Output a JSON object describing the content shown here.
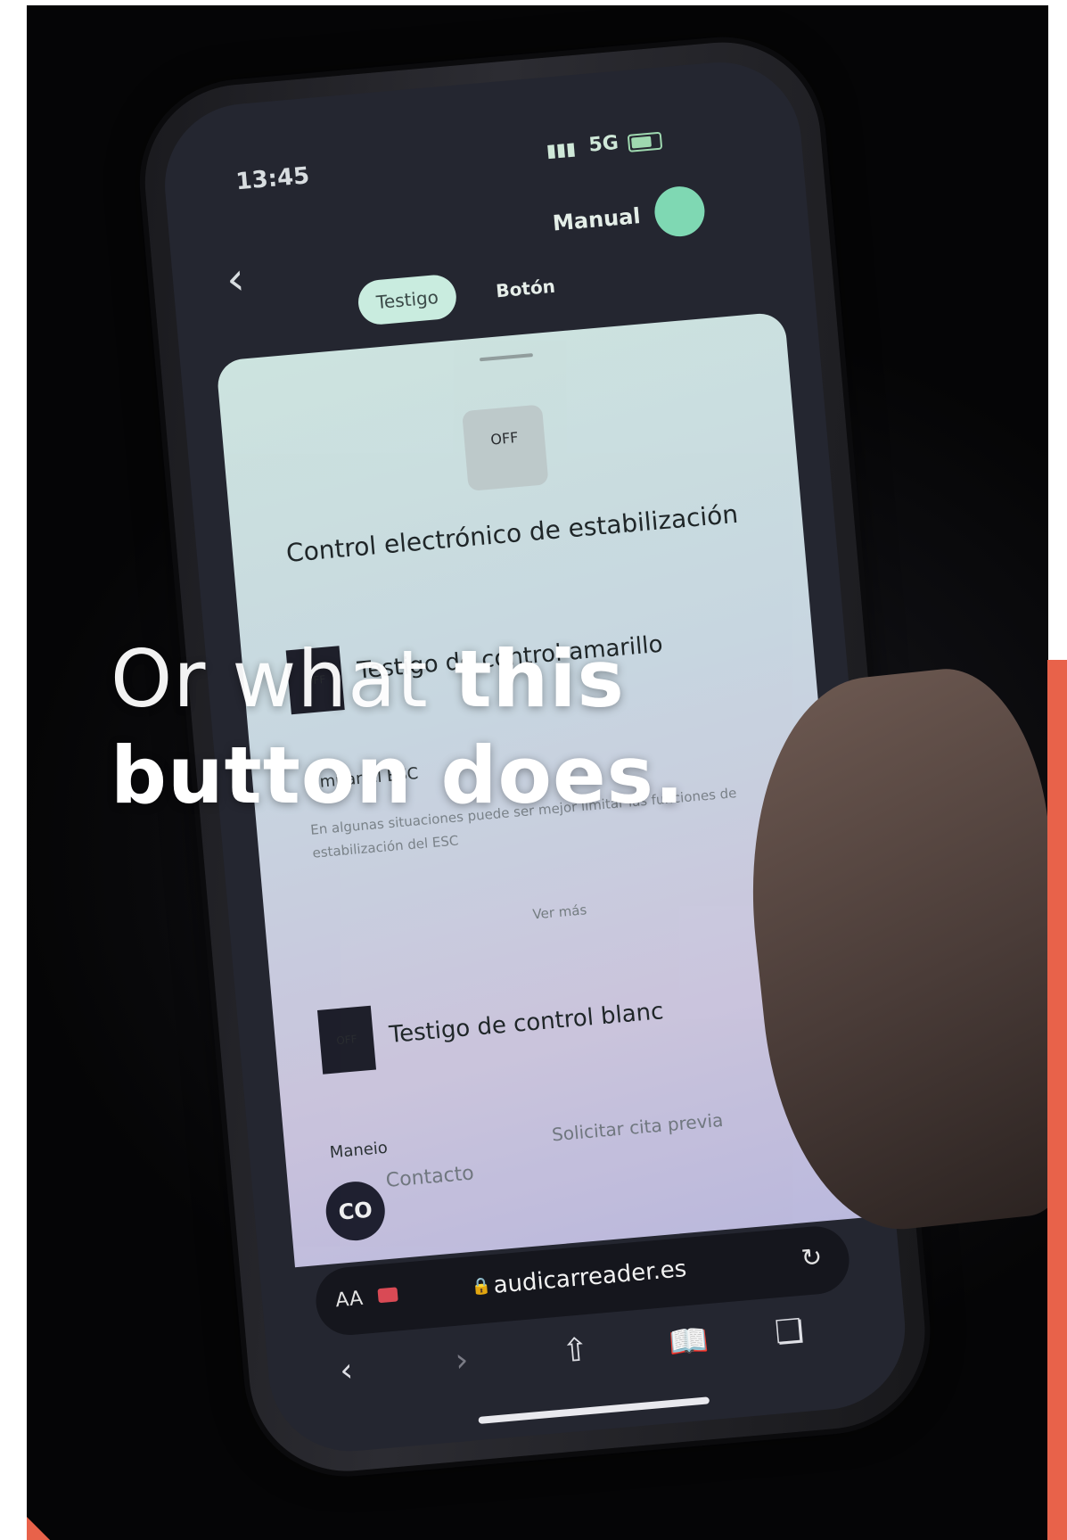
{
  "overlay": {
    "line1_light": "Or what ",
    "line1_bold": "this",
    "line2_bold": "button does."
  },
  "phone": {
    "status": {
      "time": "13:45",
      "network": "5G",
      "signal_icon": "signal-bars-icon",
      "battery_icon": "battery-icon"
    },
    "header": {
      "back_icon": "chevron-left-icon",
      "manual_label": "Manual",
      "tabs": [
        {
          "label": "Testigo"
        },
        {
          "label": "Botón"
        }
      ]
    },
    "sheet": {
      "icon_label": "OFF",
      "title": "Control electrónico de estabilización",
      "rows": [
        {
          "icon_label": "OFF",
          "text": "Testigo de control amarillo"
        },
        {
          "icon_label": "OFF",
          "text": "Testigo de control blanc"
        }
      ],
      "sub_heading": "Limitar el ESC",
      "sub_text": "En algunas situaciones puede ser mejor limitar las funciones de estabilización del ESC",
      "more_link": "Ver más",
      "section_label": "Maneio",
      "appointment_link": "Solicitar cita previa",
      "contact_link": "Contacto",
      "logo_label": "CO"
    },
    "browser": {
      "aa_label": "AA",
      "url": "audicarreader.es",
      "icons": [
        "camera-icon",
        "lock-icon",
        "reload-icon",
        "back-icon",
        "forward-icon",
        "share-icon",
        "bookmarks-icon",
        "tabs-icon"
      ]
    }
  },
  "colors": {
    "accent": "#e8624a",
    "tab_active": "#c9ecdf",
    "avatar": "#7fd8b3"
  }
}
